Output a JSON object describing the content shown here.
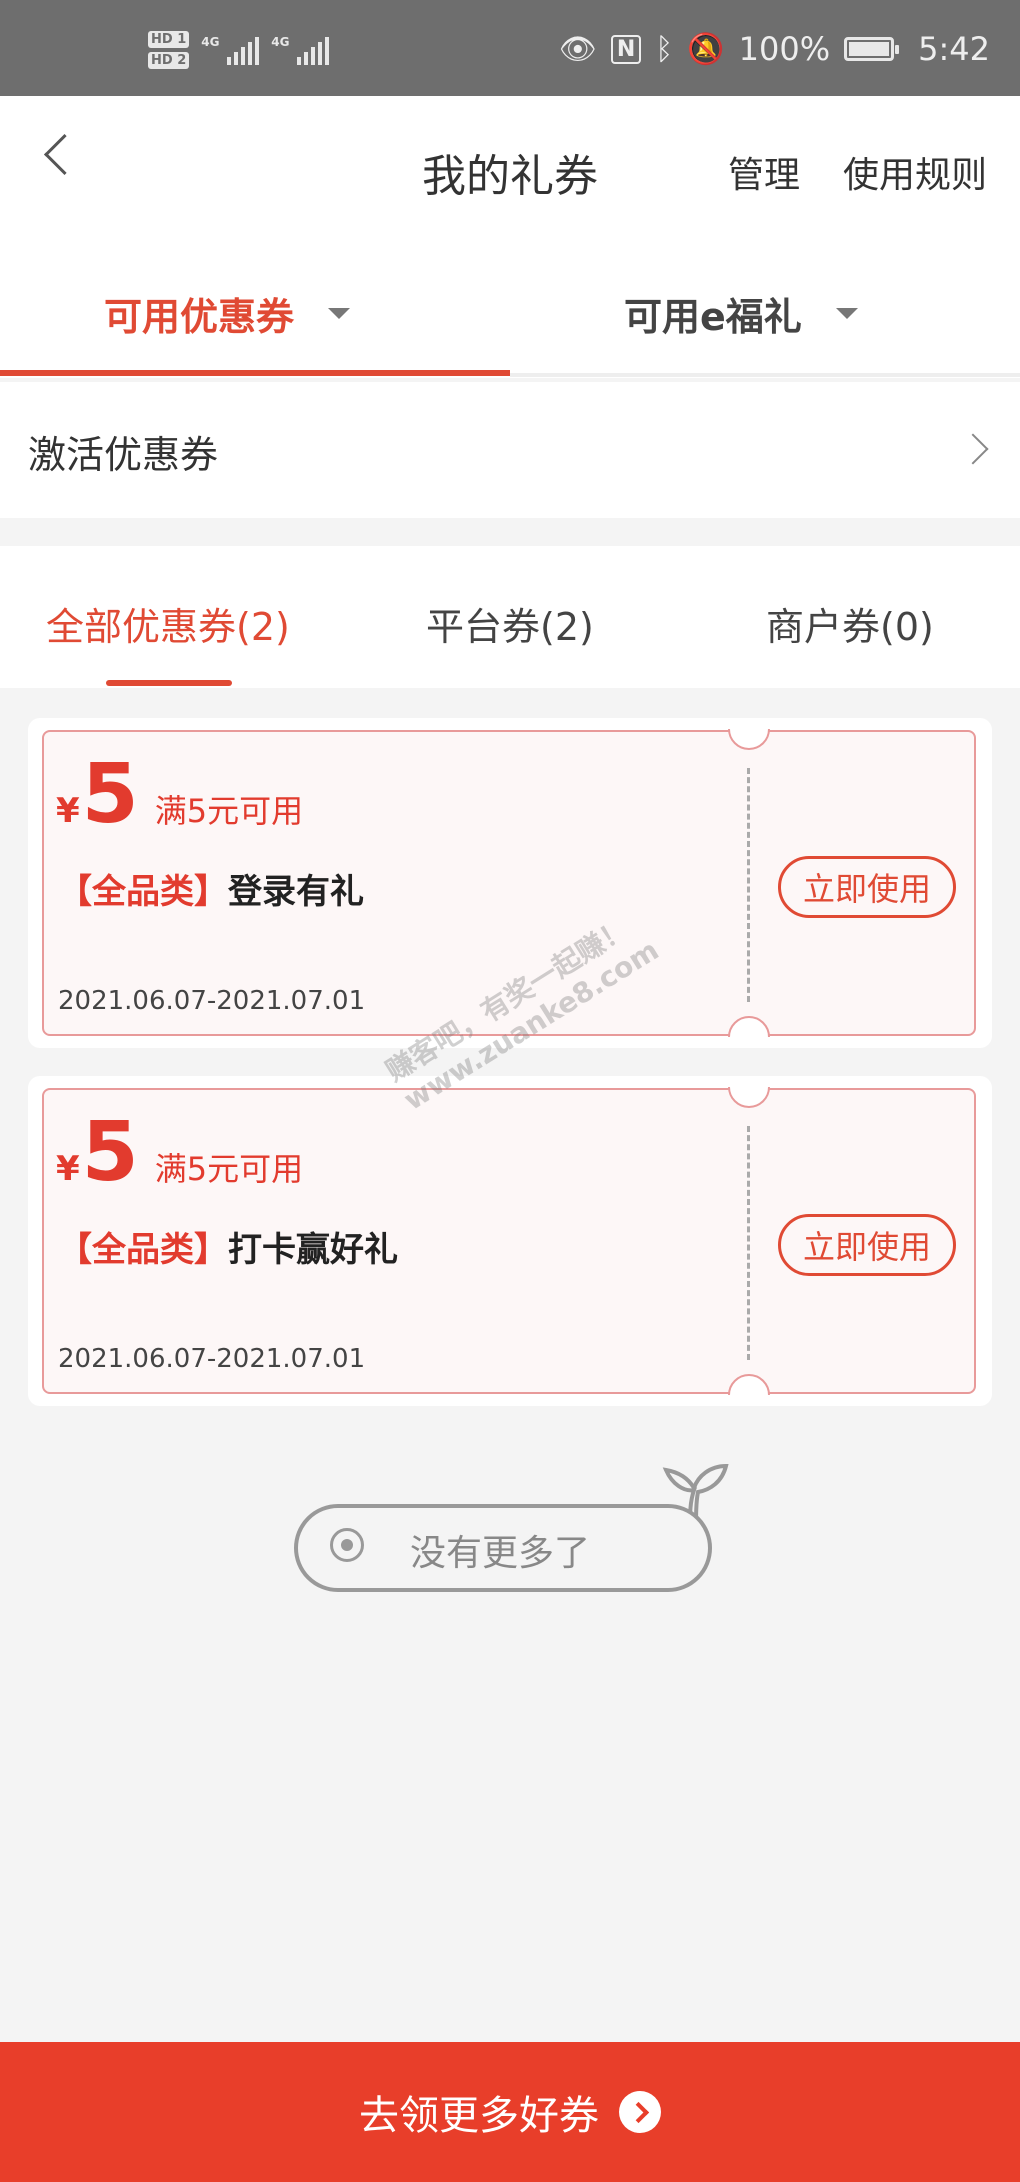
{
  "status_bar": {
    "hd1": "HD 1",
    "hd2": "HD 2",
    "net1": "4G",
    "net2": "4G",
    "battery": "100%",
    "time": "5:42"
  },
  "nav": {
    "title": "我的礼券",
    "manage": "管理",
    "rules": "使用规则"
  },
  "top_tabs": [
    {
      "label": "可用优惠券",
      "active": true
    },
    {
      "label": "可用e福礼",
      "active": false
    }
  ],
  "activate": {
    "label": "激活优惠券"
  },
  "sub_tabs": [
    {
      "label": "全部优惠券(2)",
      "active": true
    },
    {
      "label": "平台券(2)",
      "active": false
    },
    {
      "label": "商户券(0)",
      "active": false
    }
  ],
  "coupons": [
    {
      "currency": "¥",
      "amount": "5",
      "condition": "满5元可用",
      "category": "【全品类】",
      "name": "登录有礼",
      "date_range": "2021.06.07-2021.07.01",
      "button": "立即使用"
    },
    {
      "currency": "¥",
      "amount": "5",
      "condition": "满5元可用",
      "category": "【全品类】",
      "name": "打卡赢好礼",
      "date_range": "2021.06.07-2021.07.01",
      "button": "立即使用"
    }
  ],
  "empty_hint": "没有更多了",
  "bottom_button": "去领更多好券",
  "watermark": {
    "line1": "赚客吧，有奖一起赚！",
    "line2": "www.zuanke8.com"
  },
  "colors": {
    "accent": "#e04a34",
    "bottom_bar": "#e83e2a",
    "coupon_border": "#e89a9a",
    "status_bar": "#6e6e6e"
  }
}
